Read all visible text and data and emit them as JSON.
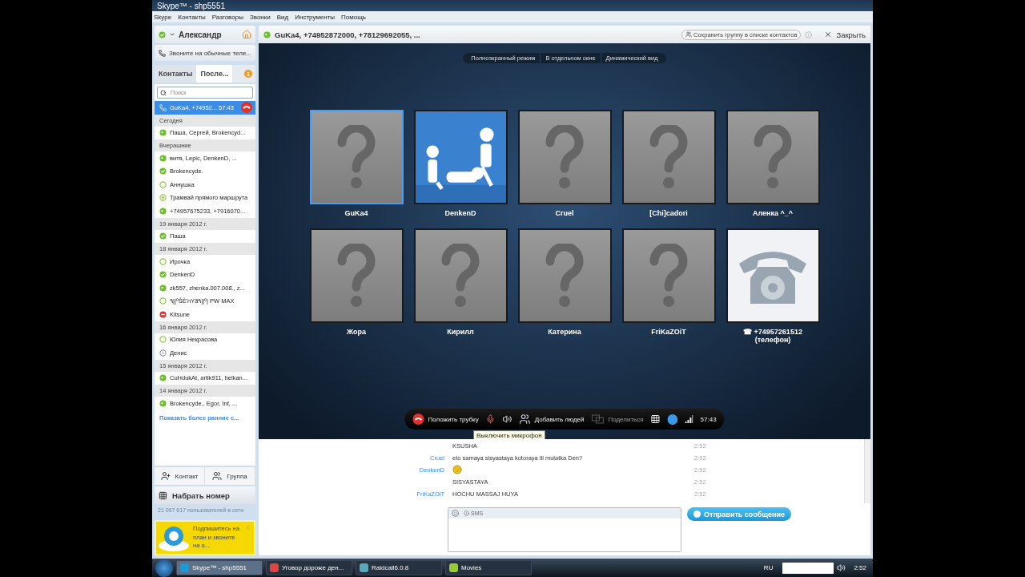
{
  "window": {
    "title": "Skype™ - shp5551"
  },
  "menu": [
    "Skype",
    "Контакты",
    "Разговоры",
    "Звонки",
    "Вид",
    "Инструменты",
    "Помощь"
  ],
  "profile": {
    "name": "Александр"
  },
  "promo_call": "Звоните на обычные теле...",
  "tabs": [
    {
      "label": "Контакты",
      "selected": false
    },
    {
      "label": "После...",
      "selected": true
    }
  ],
  "tab_badge": "1",
  "search": {
    "placeholder": "Поиск"
  },
  "recent": [
    {
      "kind": "call",
      "label": "GuKa4, +74952... 57:43",
      "selected": true
    },
    {
      "kind": "header",
      "label": "Сегодня"
    },
    {
      "kind": "group",
      "label": "Паша, Сергей, Brokencyd...",
      "selected": false
    },
    {
      "kind": "header",
      "label": "Вчерашние"
    },
    {
      "kind": "group",
      "label": "витя, Lepic, DenkenD, ...",
      "selected": false
    },
    {
      "kind": "online",
      "label": "Brokencyde.",
      "selected": false
    },
    {
      "kind": "offline",
      "label": "Аннушка",
      "selected": false
    },
    {
      "kind": "pending",
      "label": "Трамвай прямого маршрута",
      "selected": false
    },
    {
      "kind": "group",
      "label": "+74957675233, +7916070...",
      "selected": false
    },
    {
      "kind": "header",
      "label": "19 января 2012 г."
    },
    {
      "kind": "online",
      "label": "Паша",
      "selected": false
    },
    {
      "kind": "header",
      "label": "18 января 2012 г."
    },
    {
      "kind": "offline",
      "label": "Ирочка",
      "selected": false
    },
    {
      "kind": "online",
      "label": "DenkenD",
      "selected": false
    },
    {
      "kind": "group",
      "label": "zk557, zhenka.007.008., z...",
      "selected": false
    },
    {
      "kind": "offline",
      "label": "٩||ºŠÈ'nYã٩||º| PW MAX",
      "selected": false
    },
    {
      "kind": "busy",
      "label": "Kitsune",
      "selected": false
    },
    {
      "kind": "header",
      "label": "16 января 2012 г."
    },
    {
      "kind": "offline",
      "label": "Юлия Некрасова",
      "selected": false
    },
    {
      "kind": "unknown",
      "label": "Денис",
      "selected": false
    },
    {
      "kind": "header",
      "label": "15 января 2012 г."
    },
    {
      "kind": "group",
      "label": "CuHdukAt, artik911, belkan...",
      "selected": false
    },
    {
      "kind": "header",
      "label": "14 января 2012 г."
    },
    {
      "kind": "group",
      "label": "Brokencyde., Egor, Inf, ...",
      "selected": false
    }
  ],
  "show_more": "Показать более ранние с...",
  "add_buttons": [
    {
      "kind": "contact",
      "label": "Контакт"
    },
    {
      "kind": "group",
      "label": "Группа"
    }
  ],
  "dial": "Набрать номер",
  "online_count": "21 097 617 пользователей в сети",
  "ad": {
    "text": "Подпишитесь на план и звоните на о..."
  },
  "call": {
    "title": "GuKa4, +74952872000, +78129692055, ...",
    "save_group": "Сохранить группу в списке контактов",
    "close": "Закрыть",
    "view_modes": [
      "Полноэкранный режим",
      "В отдельном окне",
      "Динамический вид"
    ],
    "participants": [
      {
        "name": "GuKa4",
        "kind": "unknown",
        "selected": true
      },
      {
        "name": "DenkenD",
        "kind": "picture",
        "selected": false
      },
      {
        "name": "Cruel",
        "kind": "unknown",
        "selected": false
      },
      {
        "name": "[Chi]cadori",
        "kind": "unknown",
        "selected": false
      },
      {
        "name": "Аленка ^_^",
        "kind": "unknown",
        "selected": false
      },
      {
        "name": "Жора",
        "kind": "unknown",
        "selected": false
      },
      {
        "name": "Кирилл",
        "kind": "unknown",
        "selected": false
      },
      {
        "name": "Катерина",
        "kind": "unknown",
        "selected": false
      },
      {
        "name": "FriKaZOiT",
        "kind": "unknown",
        "selected": false
      },
      {
        "name": "☎ +74957261512",
        "subtitle": "(телефон)",
        "kind": "phone",
        "selected": false
      }
    ],
    "controls": [
      {
        "kind": "hangup",
        "label": "Положить трубку",
        "disabled": false
      },
      {
        "kind": "mic",
        "disabled": false
      },
      {
        "kind": "speaker",
        "disabled": false
      },
      {
        "kind": "add",
        "label": "Добавить людей",
        "disabled": false
      },
      {
        "kind": "share",
        "label": "Поделиться",
        "disabled": true
      },
      {
        "kind": "dialpad",
        "disabled": false
      },
      {
        "kind": "status",
        "disabled": false
      },
      {
        "kind": "signal",
        "disabled": false
      },
      {
        "kind": "timer",
        "label": "57:43",
        "disabled": false
      }
    ],
    "tooltip": "Выключить микрофон"
  },
  "chat": {
    "messages": [
      {
        "kind": "text",
        "text": "KSUSHA",
        "time": "2:52"
      },
      {
        "kind": "text",
        "sender": "Cruel",
        "text": "eto samaya sisyastaya kotoraya ili mulatka Den?",
        "time": "2:52"
      },
      {
        "kind": "emoji",
        "sender": "DenkenD",
        "time": "2:52"
      },
      {
        "kind": "text",
        "text": "SISYASTAYA",
        "time": "2:52"
      },
      {
        "kind": "text",
        "sender": "FriKaZOiT",
        "text": "HOCHU MASSAJ HUYA",
        "time": "2:52"
      }
    ]
  },
  "composer": {
    "sms": "SMS",
    "send": "Отправить сообщение"
  },
  "taskbar": {
    "tasks": [
      {
        "label": "Skype™ - shp5551",
        "kind": "skype",
        "selected": true
      },
      {
        "label": "Уговор дороже ден...",
        "kind": "browser",
        "selected": false
      },
      {
        "label": "Raidcall6.0.8",
        "kind": "raidcall",
        "selected": false
      },
      {
        "label": "Movies",
        "kind": "folder",
        "selected": false
      }
    ],
    "language": "RU",
    "clock": "2:52"
  }
}
